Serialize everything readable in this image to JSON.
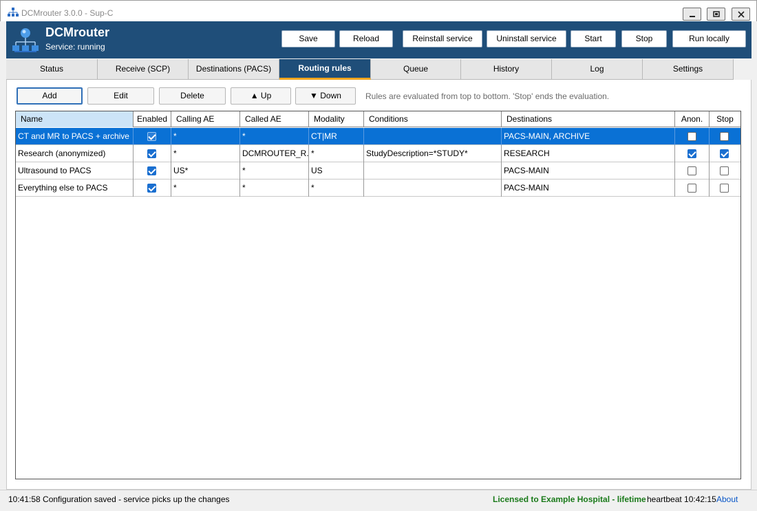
{
  "window": {
    "title": "DCMrouter 3.0.0 - Sup-C"
  },
  "header": {
    "app_name": "DCMrouter",
    "status": "Service: running",
    "buttons": [
      "Save",
      "Reload",
      "Reinstall service",
      "Uninstall service",
      "Start",
      "Stop",
      "Run locally"
    ]
  },
  "tabs": [
    "Status",
    "Receive (SCP)",
    "Destinations (PACS)",
    "Routing rules",
    "Queue",
    "History",
    "Log",
    "Settings"
  ],
  "active_tab": "Routing rules",
  "toolbar": {
    "add": "Add",
    "edit": "Edit",
    "delete": "Delete",
    "up": "▲ Up",
    "down": "▼ Down",
    "hint": "Rules are evaluated from top to bottom. 'Stop' ends the evaluation."
  },
  "grid": {
    "columns": [
      "Name",
      "Enabled",
      "Calling AE",
      "Called AE",
      "Modality",
      "Conditions",
      "Destinations",
      "Anon.",
      "Stop"
    ],
    "rows": [
      {
        "name": "CT and MR to PACS + archive",
        "enabled": true,
        "calling_ae": "*",
        "called_ae": "*",
        "modality": "CT|MR",
        "conditions": "",
        "destinations": "PACS-MAIN, ARCHIVE",
        "anon": false,
        "stop": false,
        "selected": true
      },
      {
        "name": "Research (anonymized)",
        "enabled": true,
        "calling_ae": "*",
        "called_ae": "DCMROUTER_R...",
        "modality": "*",
        "conditions": "StudyDescription=*STUDY*",
        "destinations": "RESEARCH",
        "anon": true,
        "stop": true,
        "selected": false
      },
      {
        "name": "Ultrasound to PACS",
        "enabled": true,
        "calling_ae": "US*",
        "called_ae": "*",
        "modality": "US",
        "conditions": "",
        "destinations": "PACS-MAIN",
        "anon": false,
        "stop": false,
        "selected": false
      },
      {
        "name": "Everything else to PACS",
        "enabled": true,
        "calling_ae": "*",
        "called_ae": "*",
        "modality": "*",
        "conditions": "",
        "destinations": "PACS-MAIN",
        "anon": false,
        "stop": false,
        "selected": false
      }
    ]
  },
  "statusbar": {
    "message": "10:41:58  Configuration saved - service picks up the changes",
    "license": "Licensed to Example Hospital - lifetime",
    "heartbeat": "heartbeat 10:42:15",
    "about": "About"
  },
  "colors": {
    "header": "#1f4e79",
    "accent": "#f0a51e",
    "selection": "#0a71d5",
    "license": "#1a7a1a"
  }
}
